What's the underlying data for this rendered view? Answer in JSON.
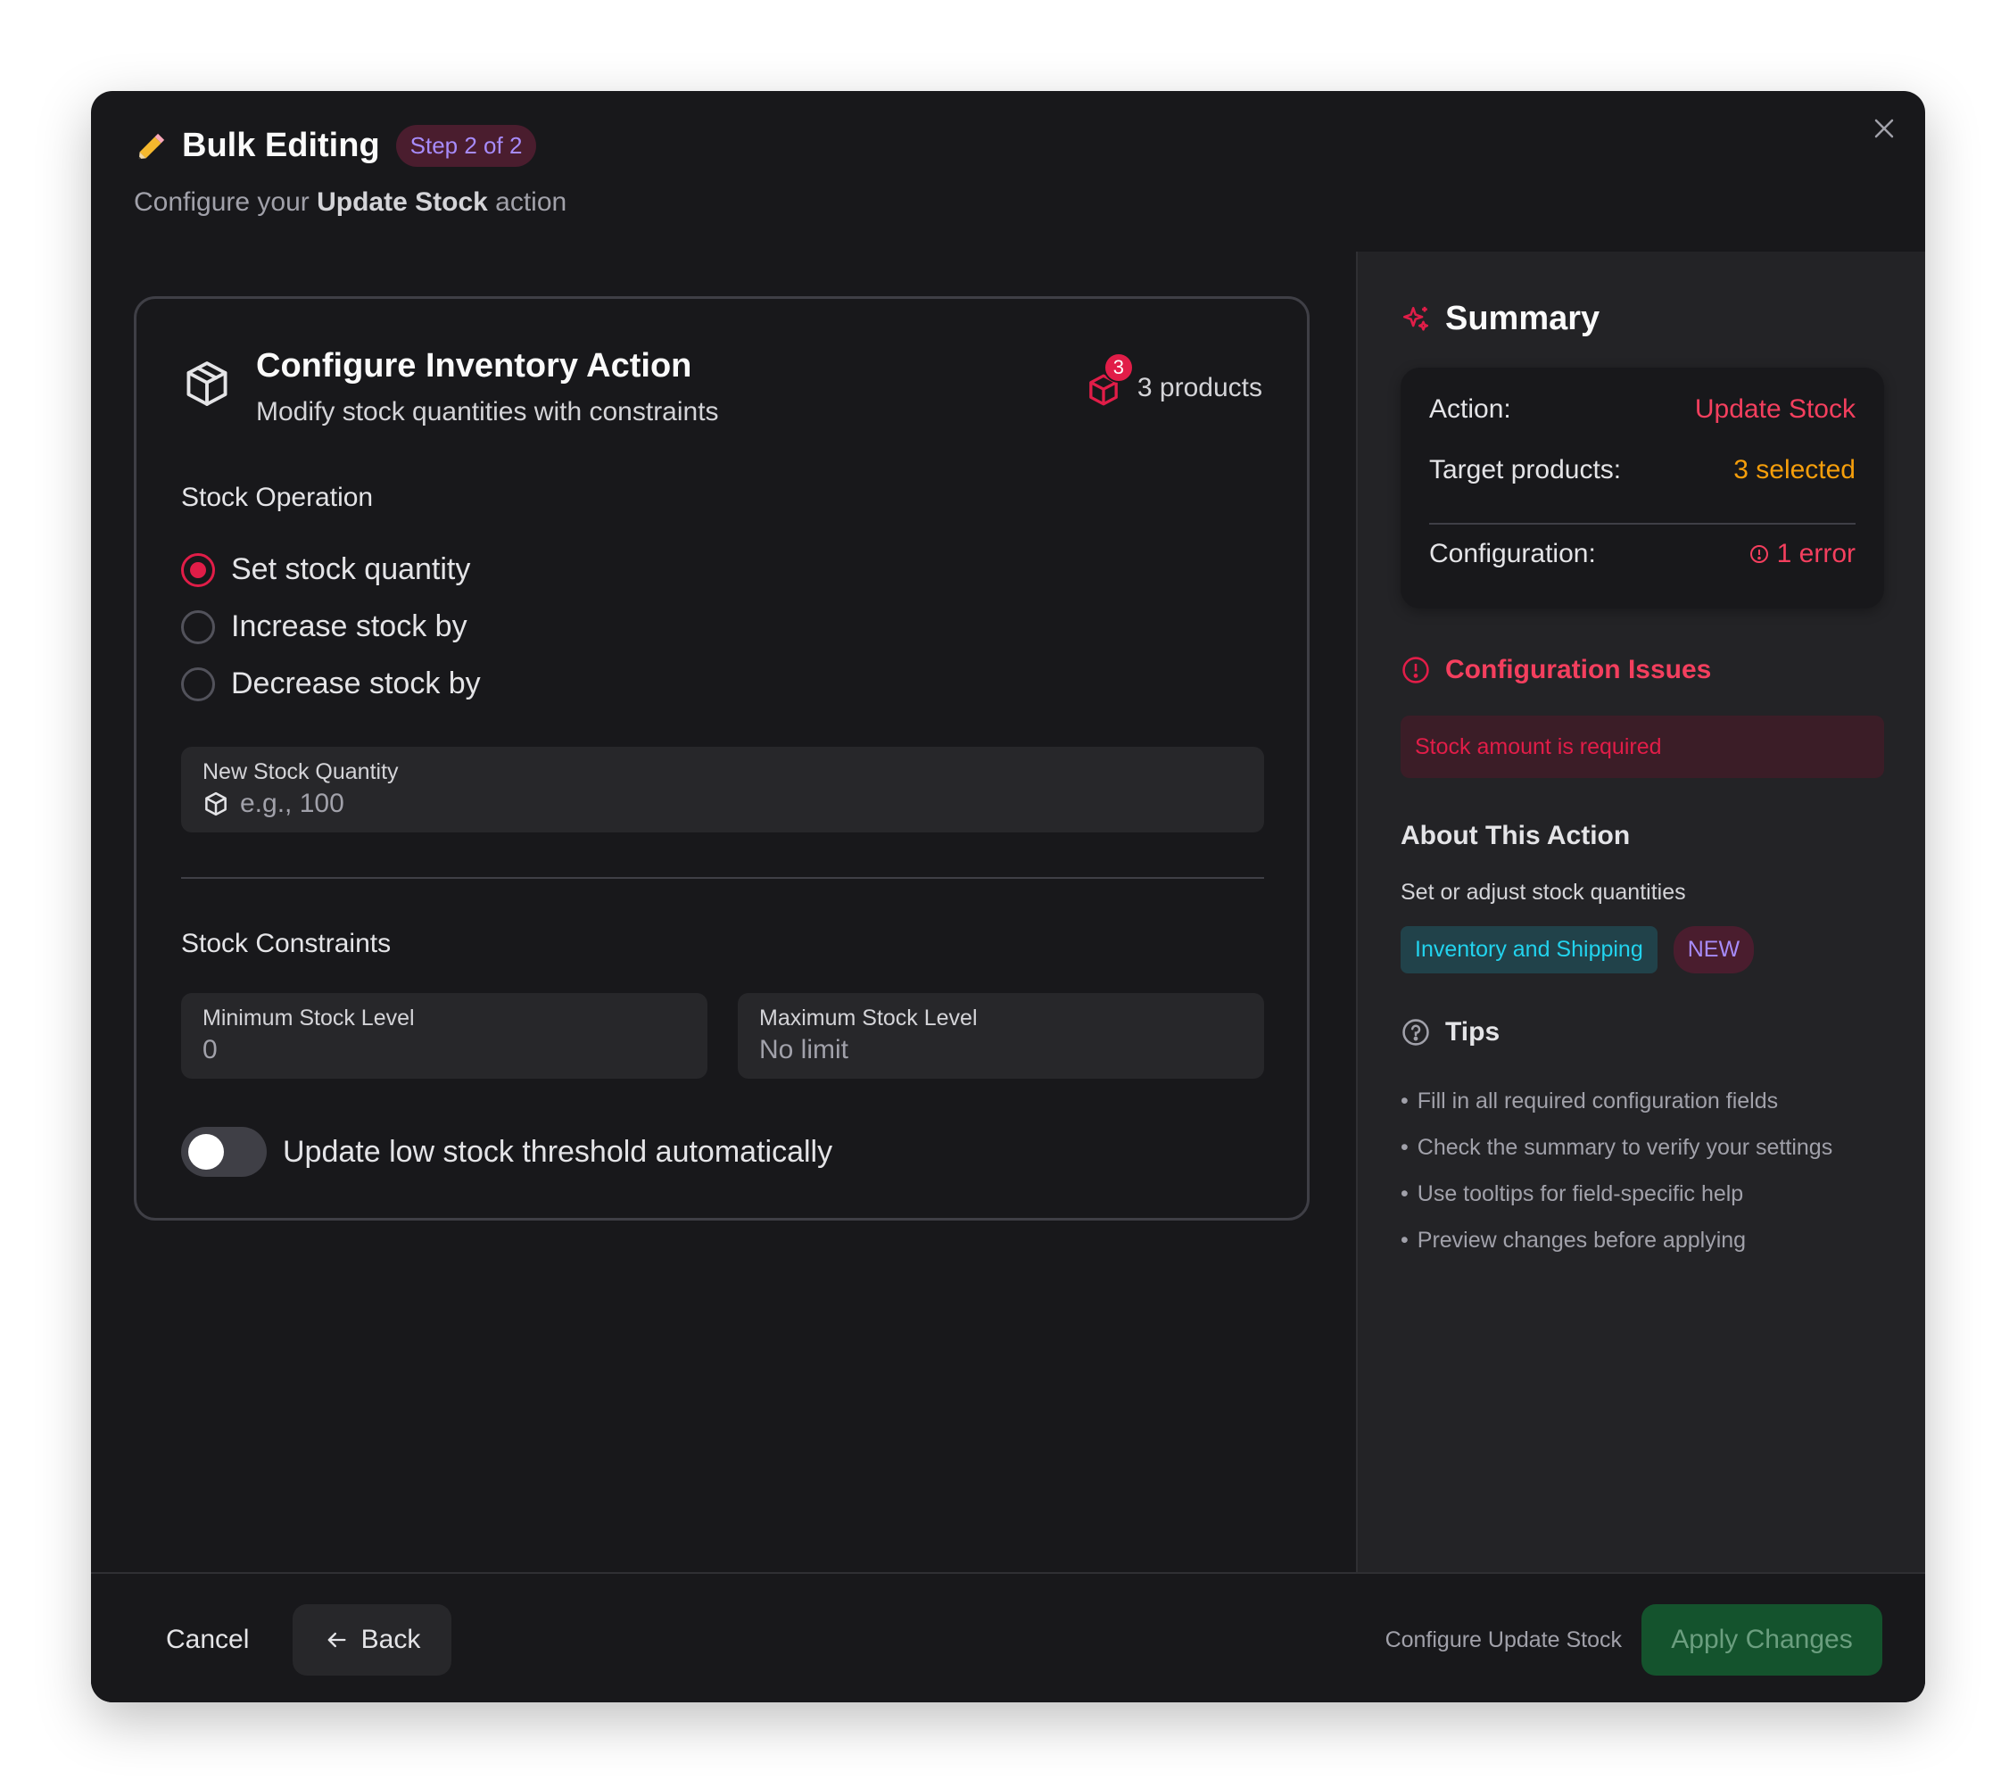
{
  "header": {
    "title": "Bulk Editing",
    "step_badge": "Step 2 of 2",
    "subtitle_prefix": "Configure your ",
    "subtitle_bold": "Update Stock",
    "subtitle_suffix": " action",
    "icon": "pencil-icon",
    "close_icon": "close-icon"
  },
  "card": {
    "title": "Configure Inventory Action",
    "subtitle": "Modify stock quantities with constraints",
    "icon": "box-icon",
    "product_count_badge": "3",
    "products_label": "3 products"
  },
  "stock_operation": {
    "label": "Stock Operation",
    "options": [
      {
        "label": "Set stock quantity",
        "checked": true
      },
      {
        "label": "Increase stock by",
        "checked": false
      },
      {
        "label": "Decrease stock by",
        "checked": false
      }
    ]
  },
  "new_stock_field": {
    "label": "New Stock Quantity",
    "placeholder": "e.g., 100",
    "value": ""
  },
  "constraints": {
    "label": "Stock Constraints",
    "min": {
      "label": "Minimum Stock Level",
      "placeholder": "0"
    },
    "max": {
      "label": "Maximum Stock Level",
      "placeholder": "No limit"
    }
  },
  "toggle": {
    "label": "Update low stock threshold automatically",
    "on": false
  },
  "summary": {
    "title": "Summary",
    "rows": [
      {
        "key": "Action:",
        "value": "Update Stock",
        "color": "#f43f5e"
      },
      {
        "key": "Target products:",
        "value": "3 selected",
        "color": "#f59e0b"
      },
      {
        "key": "Configuration:",
        "value": "1 error",
        "color": "#f43f5e"
      }
    ]
  },
  "issues": {
    "title": "Configuration Issues",
    "items": [
      "Stock amount is required"
    ]
  },
  "about": {
    "title": "About This Action",
    "text": "Set or adjust stock quantities",
    "category_tag": "Inventory and Shipping",
    "new_tag": "NEW"
  },
  "tips": {
    "title": "Tips",
    "items": [
      "Fill in all required configuration fields",
      "Check the summary to verify your settings",
      "Use tooltips for field-specific help",
      "Preview changes before applying"
    ]
  },
  "footer": {
    "cancel": "Cancel",
    "back": "Back",
    "status": "Configure Update Stock",
    "apply": "Apply Changes"
  },
  "colors": {
    "accent": "#e11d48",
    "background": "#18181b",
    "panel": "#232326",
    "apply_bg": "#14532d"
  }
}
